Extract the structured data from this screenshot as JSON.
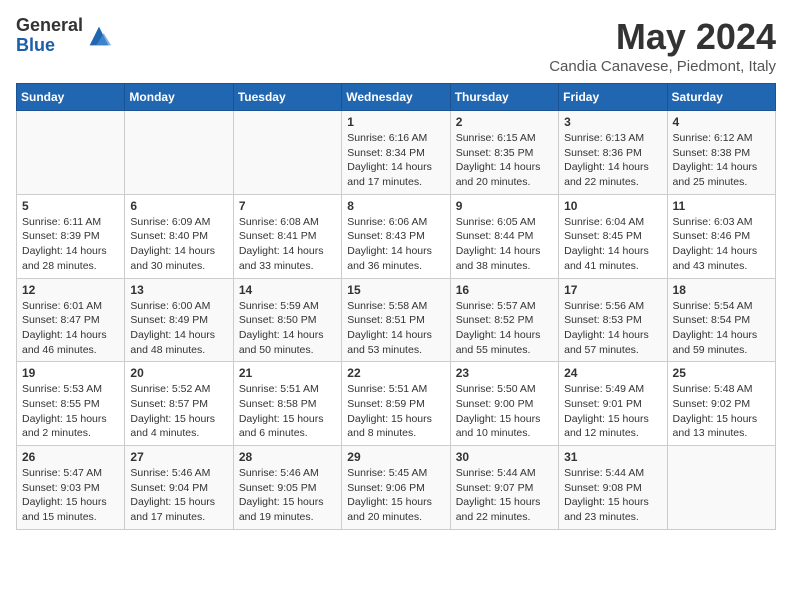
{
  "header": {
    "logo_general": "General",
    "logo_blue": "Blue",
    "title": "May 2024",
    "location": "Candia Canavese, Piedmont, Italy"
  },
  "weekdays": [
    "Sunday",
    "Monday",
    "Tuesday",
    "Wednesday",
    "Thursday",
    "Friday",
    "Saturday"
  ],
  "weeks": [
    [
      {
        "day": "",
        "info": ""
      },
      {
        "day": "",
        "info": ""
      },
      {
        "day": "",
        "info": ""
      },
      {
        "day": "1",
        "info": "Sunrise: 6:16 AM\nSunset: 8:34 PM\nDaylight: 14 hours\nand 17 minutes."
      },
      {
        "day": "2",
        "info": "Sunrise: 6:15 AM\nSunset: 8:35 PM\nDaylight: 14 hours\nand 20 minutes."
      },
      {
        "day": "3",
        "info": "Sunrise: 6:13 AM\nSunset: 8:36 PM\nDaylight: 14 hours\nand 22 minutes."
      },
      {
        "day": "4",
        "info": "Sunrise: 6:12 AM\nSunset: 8:38 PM\nDaylight: 14 hours\nand 25 minutes."
      }
    ],
    [
      {
        "day": "5",
        "info": "Sunrise: 6:11 AM\nSunset: 8:39 PM\nDaylight: 14 hours\nand 28 minutes."
      },
      {
        "day": "6",
        "info": "Sunrise: 6:09 AM\nSunset: 8:40 PM\nDaylight: 14 hours\nand 30 minutes."
      },
      {
        "day": "7",
        "info": "Sunrise: 6:08 AM\nSunset: 8:41 PM\nDaylight: 14 hours\nand 33 minutes."
      },
      {
        "day": "8",
        "info": "Sunrise: 6:06 AM\nSunset: 8:43 PM\nDaylight: 14 hours\nand 36 minutes."
      },
      {
        "day": "9",
        "info": "Sunrise: 6:05 AM\nSunset: 8:44 PM\nDaylight: 14 hours\nand 38 minutes."
      },
      {
        "day": "10",
        "info": "Sunrise: 6:04 AM\nSunset: 8:45 PM\nDaylight: 14 hours\nand 41 minutes."
      },
      {
        "day": "11",
        "info": "Sunrise: 6:03 AM\nSunset: 8:46 PM\nDaylight: 14 hours\nand 43 minutes."
      }
    ],
    [
      {
        "day": "12",
        "info": "Sunrise: 6:01 AM\nSunset: 8:47 PM\nDaylight: 14 hours\nand 46 minutes."
      },
      {
        "day": "13",
        "info": "Sunrise: 6:00 AM\nSunset: 8:49 PM\nDaylight: 14 hours\nand 48 minutes."
      },
      {
        "day": "14",
        "info": "Sunrise: 5:59 AM\nSunset: 8:50 PM\nDaylight: 14 hours\nand 50 minutes."
      },
      {
        "day": "15",
        "info": "Sunrise: 5:58 AM\nSunset: 8:51 PM\nDaylight: 14 hours\nand 53 minutes."
      },
      {
        "day": "16",
        "info": "Sunrise: 5:57 AM\nSunset: 8:52 PM\nDaylight: 14 hours\nand 55 minutes."
      },
      {
        "day": "17",
        "info": "Sunrise: 5:56 AM\nSunset: 8:53 PM\nDaylight: 14 hours\nand 57 minutes."
      },
      {
        "day": "18",
        "info": "Sunrise: 5:54 AM\nSunset: 8:54 PM\nDaylight: 14 hours\nand 59 minutes."
      }
    ],
    [
      {
        "day": "19",
        "info": "Sunrise: 5:53 AM\nSunset: 8:55 PM\nDaylight: 15 hours\nand 2 minutes."
      },
      {
        "day": "20",
        "info": "Sunrise: 5:52 AM\nSunset: 8:57 PM\nDaylight: 15 hours\nand 4 minutes."
      },
      {
        "day": "21",
        "info": "Sunrise: 5:51 AM\nSunset: 8:58 PM\nDaylight: 15 hours\nand 6 minutes."
      },
      {
        "day": "22",
        "info": "Sunrise: 5:51 AM\nSunset: 8:59 PM\nDaylight: 15 hours\nand 8 minutes."
      },
      {
        "day": "23",
        "info": "Sunrise: 5:50 AM\nSunset: 9:00 PM\nDaylight: 15 hours\nand 10 minutes."
      },
      {
        "day": "24",
        "info": "Sunrise: 5:49 AM\nSunset: 9:01 PM\nDaylight: 15 hours\nand 12 minutes."
      },
      {
        "day": "25",
        "info": "Sunrise: 5:48 AM\nSunset: 9:02 PM\nDaylight: 15 hours\nand 13 minutes."
      }
    ],
    [
      {
        "day": "26",
        "info": "Sunrise: 5:47 AM\nSunset: 9:03 PM\nDaylight: 15 hours\nand 15 minutes."
      },
      {
        "day": "27",
        "info": "Sunrise: 5:46 AM\nSunset: 9:04 PM\nDaylight: 15 hours\nand 17 minutes."
      },
      {
        "day": "28",
        "info": "Sunrise: 5:46 AM\nSunset: 9:05 PM\nDaylight: 15 hours\nand 19 minutes."
      },
      {
        "day": "29",
        "info": "Sunrise: 5:45 AM\nSunset: 9:06 PM\nDaylight: 15 hours\nand 20 minutes."
      },
      {
        "day": "30",
        "info": "Sunrise: 5:44 AM\nSunset: 9:07 PM\nDaylight: 15 hours\nand 22 minutes."
      },
      {
        "day": "31",
        "info": "Sunrise: 5:44 AM\nSunset: 9:08 PM\nDaylight: 15 hours\nand 23 minutes."
      },
      {
        "day": "",
        "info": ""
      }
    ]
  ]
}
